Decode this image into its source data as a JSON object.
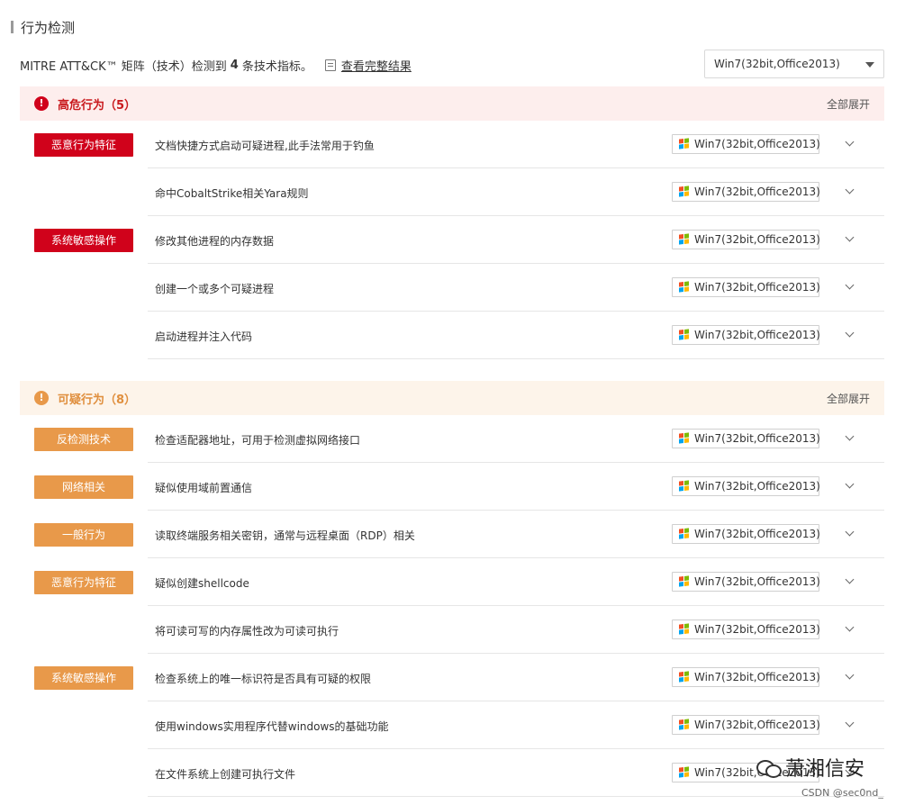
{
  "title": "行为检测",
  "summary": {
    "prefix": "MITRE ATT&CK™ 矩阵（技术）检测到",
    "count": "4",
    "suffix": "条技术指标。",
    "link": "查看完整结果"
  },
  "env_select": {
    "value": "Win7(32bit,Office2013)"
  },
  "high": {
    "title": "高危行为（5）",
    "expand": "全部展开",
    "icon": "exclamation-icon",
    "color": "#d0021b",
    "groups": [
      {
        "tag": "恶意行为特征",
        "rows": [
          {
            "desc": "文档快捷方式启动可疑进程,此手法常用于钓鱼",
            "env": "Win7(32bit,Office2013)"
          },
          {
            "desc": "命中CobaltStrike相关Yara规则",
            "env": "Win7(32bit,Office2013)"
          }
        ]
      },
      {
        "tag": "系统敏感操作",
        "rows": [
          {
            "desc": "修改其他进程的内存数据",
            "env": "Win7(32bit,Office2013)"
          },
          {
            "desc": "创建一个或多个可疑进程",
            "env": "Win7(32bit,Office2013)"
          },
          {
            "desc": "启动进程并注入代码",
            "env": "Win7(32bit,Office2013)"
          }
        ]
      }
    ]
  },
  "suspicious": {
    "title": "可疑行为（8）",
    "expand": "全部展开",
    "icon": "exclamation-icon",
    "color": "#e8994a",
    "groups": [
      {
        "tag": "反检测技术",
        "rows": [
          {
            "desc": "检查适配器地址，可用于检测虚拟网络接口",
            "env": "Win7(32bit,Office2013)"
          }
        ]
      },
      {
        "tag": "网络相关",
        "rows": [
          {
            "desc": "疑似使用域前置通信",
            "env": "Win7(32bit,Office2013)"
          }
        ]
      },
      {
        "tag": "一般行为",
        "rows": [
          {
            "desc": "读取终端服务相关密钥，通常与远程桌面（RDP）相关",
            "env": "Win7(32bit,Office2013)"
          }
        ]
      },
      {
        "tag": "恶意行为特征",
        "rows": [
          {
            "desc": "疑似创建shellcode",
            "env": "Win7(32bit,Office2013)"
          },
          {
            "desc": "将可读可写的内存属性改为可读可执行",
            "env": "Win7(32bit,Office2013)"
          }
        ]
      },
      {
        "tag": "系统敏感操作",
        "rows": [
          {
            "desc": "检查系统上的唯一标识符是否具有可疑的权限",
            "env": "Win7(32bit,Office2013)"
          },
          {
            "desc": "使用windows实用程序代替windows的基础功能",
            "env": "Win7(32bit,Office2013)"
          },
          {
            "desc": "在文件系统上创建可执行文件",
            "env": "Win7(32bit,Office2013)"
          }
        ]
      }
    ]
  },
  "watermark": {
    "text": "萧湘信安",
    "credit": "CSDN @sec0nd_"
  }
}
